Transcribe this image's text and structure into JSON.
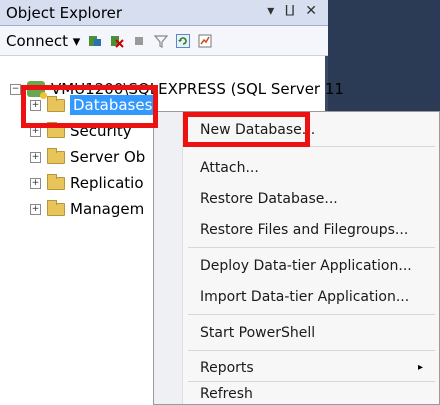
{
  "window": {
    "title": "Object Explorer",
    "controls": "▾ ⨿ ✕"
  },
  "toolbar": {
    "connect_label": "Connect ▾"
  },
  "tree": {
    "server_label": "VMU1200\\SQLEXPRESS (SQL Server 11",
    "items": [
      {
        "label": "Databases",
        "expander": "+"
      },
      {
        "label": "Security",
        "expander": "+"
      },
      {
        "label": "Server Ob",
        "expander": "+"
      },
      {
        "label": "Replicatio",
        "expander": "+"
      },
      {
        "label": "Managem",
        "expander": "+"
      }
    ],
    "server_expander": "−"
  },
  "context_menu": {
    "items": [
      {
        "label": "New Database..."
      },
      {
        "label": "Attach..."
      },
      {
        "label": "Restore Database..."
      },
      {
        "label": "Restore Files and Filegroups..."
      },
      {
        "label": "Deploy Data-tier Application..."
      },
      {
        "label": "Import Data-tier Application..."
      },
      {
        "label": "Start PowerShell"
      },
      {
        "label": "Reports"
      },
      {
        "label": "Refresh"
      }
    ],
    "submenu_arrow": "▸"
  },
  "colors": {
    "highlight": "#ee1111",
    "selection": "#3399ff"
  }
}
